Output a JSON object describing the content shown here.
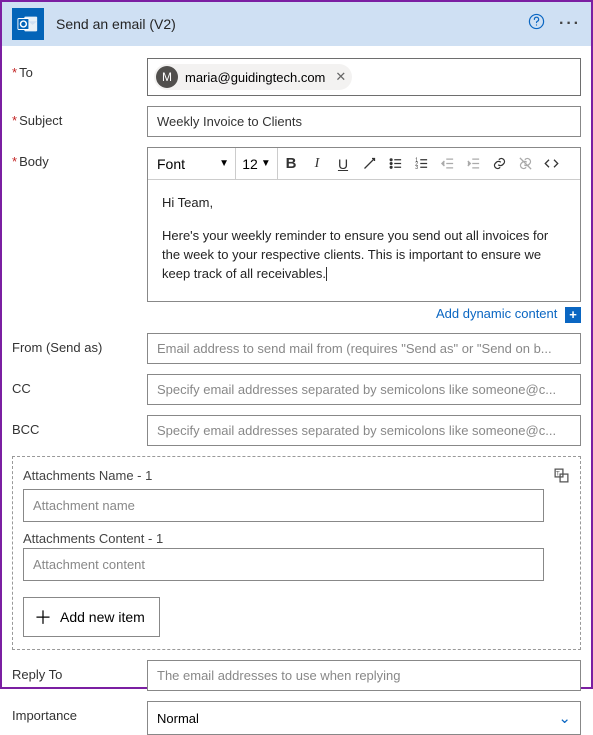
{
  "header": {
    "title": "Send an email (V2)"
  },
  "fields": {
    "to_label": "To",
    "subject_label": "Subject",
    "body_label": "Body",
    "from_label": "From (Send as)",
    "cc_label": "CC",
    "bcc_label": "BCC",
    "replyto_label": "Reply To",
    "importance_label": "Importance"
  },
  "to": {
    "chip_initial": "M",
    "chip_email": "maria@guidingtech.com"
  },
  "subject": {
    "value": "Weekly Invoice to Clients"
  },
  "editor": {
    "font_label": "Font",
    "size": "12",
    "body_p1": "Hi Team,",
    "body_p2": "Here's your weekly reminder to ensure you send out all invoices for the week to your respective clients. This is important to ensure we keep track of all receivables."
  },
  "dynamic_link": "Add dynamic content",
  "from": {
    "placeholder": "Email address to send mail from (requires \"Send as\" or \"Send on b..."
  },
  "cc": {
    "placeholder": "Specify email addresses separated by semicolons like someone@c..."
  },
  "bcc": {
    "placeholder": "Specify email addresses separated by semicolons like someone@c..."
  },
  "attachments": {
    "name_label": "Attachments Name - 1",
    "name_placeholder": "Attachment name",
    "content_label": "Attachments Content - 1",
    "content_placeholder": "Attachment content",
    "add_label": "Add new item"
  },
  "replyto": {
    "placeholder": "The email addresses to use when replying"
  },
  "importance": {
    "value": "Normal"
  }
}
